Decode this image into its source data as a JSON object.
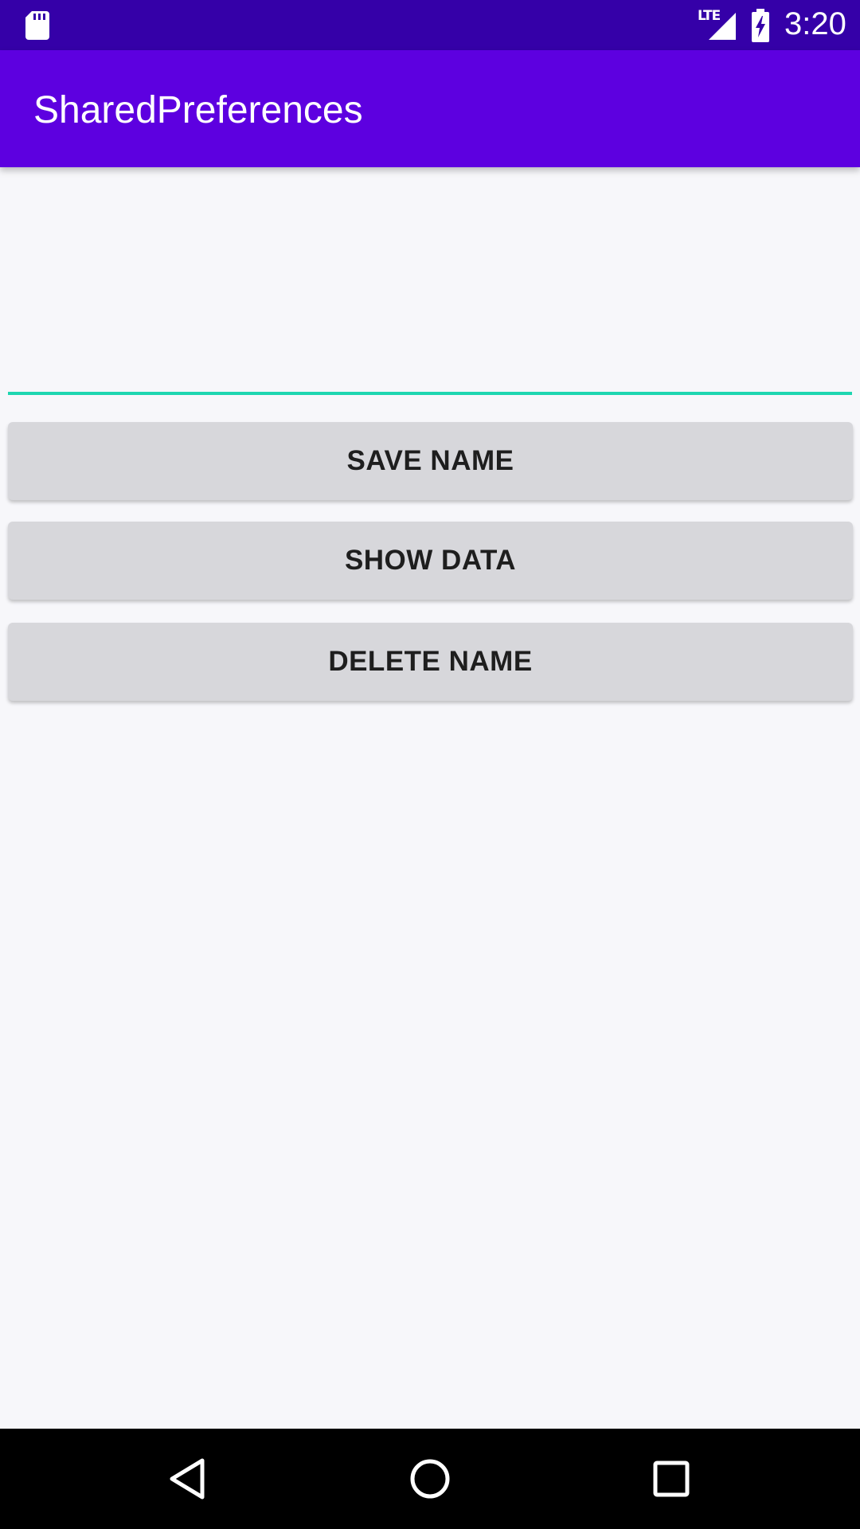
{
  "status_bar": {
    "time": "3:20",
    "network_label": "LTE",
    "icons": [
      "sd-card-icon",
      "lte-signal-icon",
      "battery-charging-icon"
    ]
  },
  "app_bar": {
    "title": "SharedPreferences"
  },
  "name_input": {
    "value": "",
    "placeholder": ""
  },
  "buttons": {
    "save": "SAVE NAME",
    "show": "SHOW DATA",
    "delete": "DELETE NAME"
  },
  "nav_bar": {
    "icons": [
      "back-icon",
      "home-icon",
      "recents-icon"
    ]
  },
  "colors": {
    "status_bar": "#3500a8",
    "app_bar": "#5d00e0",
    "input_underline": "#1ed6b0",
    "button_bg": "#d7d7db",
    "background": "#f7f7fa"
  }
}
